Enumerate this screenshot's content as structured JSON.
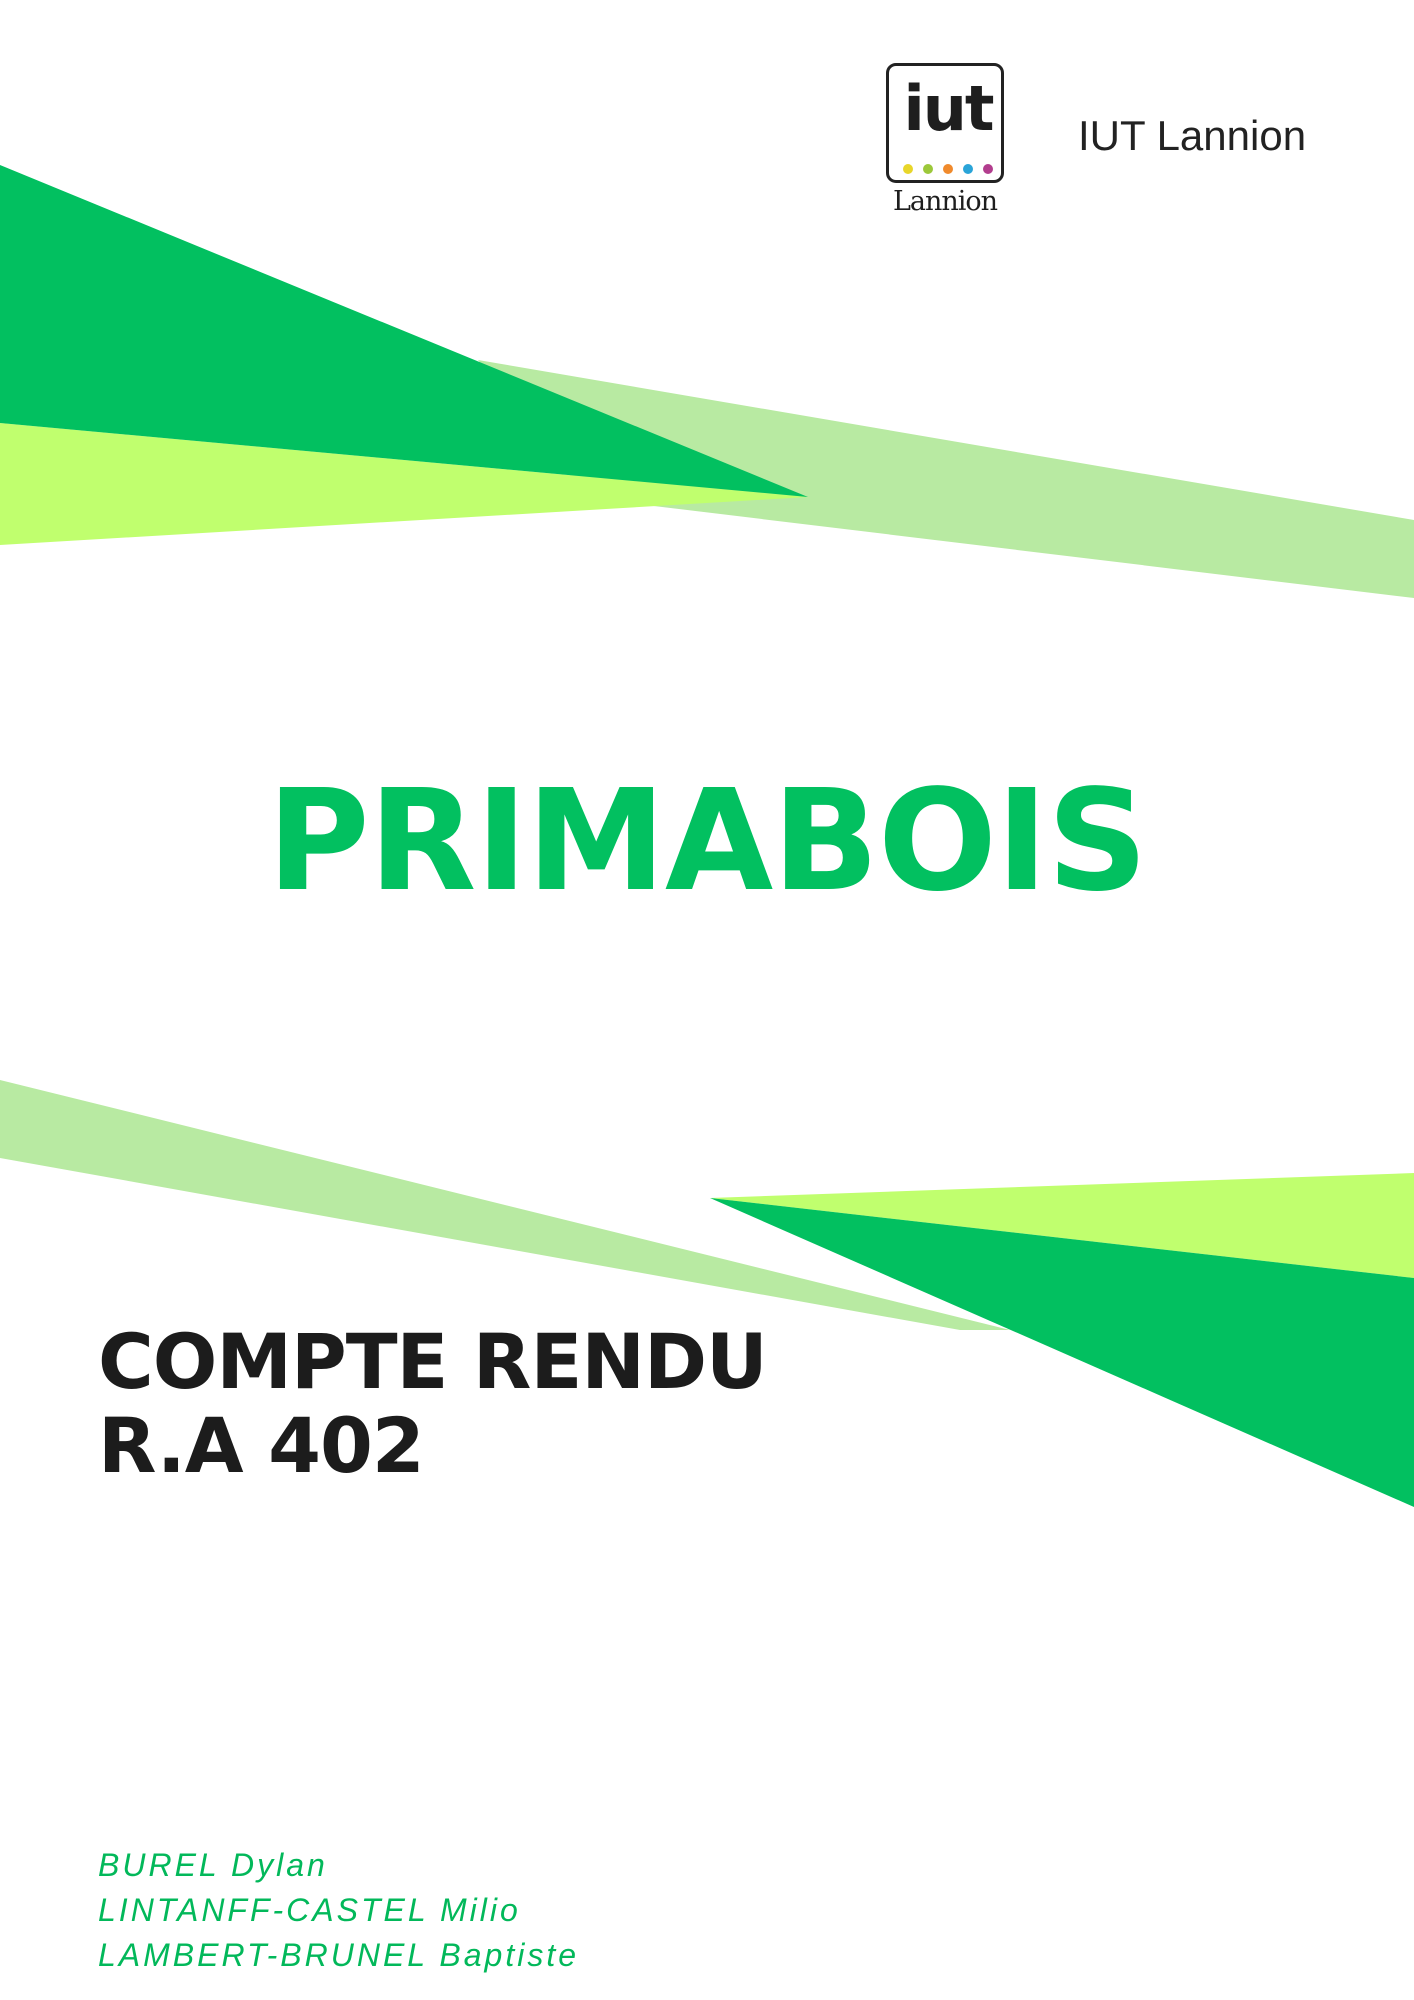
{
  "header": {
    "institution": "IUT Lannion",
    "logo_mark": "iut",
    "logo_city": "Lannion",
    "logo_dot_colors": [
      "#e8d62a",
      "#9cc83a",
      "#f08a2c",
      "#2aa4d8",
      "#b23d8e"
    ]
  },
  "title": "PRIMABOIS",
  "subtitle": {
    "line1": "COMPTE RENDU",
    "line2": "R.A 402"
  },
  "authors": [
    "BUREL Dylan",
    "LINTANFF-CASTEL Milio",
    "LAMBERT-BRUNEL Baptiste"
  ],
  "colors": {
    "green": "#02c060",
    "light_green": "#b8eaa2",
    "lime": "#c0ff6e",
    "text_dark": "#1c1c1c"
  }
}
